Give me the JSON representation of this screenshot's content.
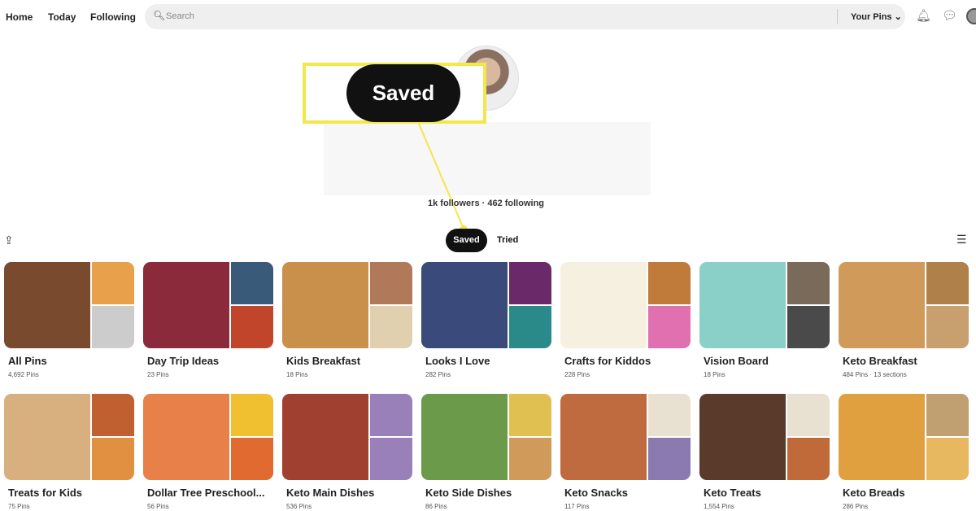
{
  "nav": {
    "home": "Home",
    "today": "Today",
    "following": "Following",
    "search_placeholder": "Search",
    "your_pins": "Your Pins"
  },
  "profile": {
    "stats": "1k followers · 462 following"
  },
  "callout": {
    "label": "Saved",
    "color": "#f2e84a"
  },
  "tabs": [
    {
      "label": "Saved",
      "active": true
    },
    {
      "label": "Tried",
      "active": false
    }
  ],
  "boards": [
    {
      "name": "All Pins",
      "count": "4,692 Pins",
      "colors": [
        "#7a4a2e",
        "#e8a04a",
        "#ccc"
      ]
    },
    {
      "name": "Day Trip Ideas",
      "count": "23 Pins",
      "colors": [
        "#8b2a3a",
        "#3a5a7a",
        "#c0452a"
      ]
    },
    {
      "name": "Kids Breakfast",
      "count": "18 Pins",
      "colors": [
        "#c8904a",
        "#b07a5a",
        "#e0d0b0"
      ]
    },
    {
      "name": "Looks I Love",
      "count": "282 Pins",
      "colors": [
        "#3a4a7a",
        "#6a2a6a",
        "#2a8a8a"
      ]
    },
    {
      "name": "Crafts for Kiddos",
      "count": "228 Pins",
      "colors": [
        "#f5f0e0",
        "#c07a3a",
        "#e070b0"
      ]
    },
    {
      "name": "Vision Board",
      "count": "18 Pins",
      "colors": [
        "#8ad0c8",
        "#7a6a5a",
        "#4a4a4a"
      ]
    },
    {
      "name": "Keto Breakfast",
      "count": "484 Pins · 13 sections",
      "colors": [
        "#d09a5a",
        "#b0804a",
        "#c8a070"
      ]
    },
    {
      "name": "Treats for Kids",
      "count": "75 Pins",
      "colors": [
        "#d8b080",
        "#c06030",
        "#e09040"
      ]
    },
    {
      "name": "Dollar Tree Preschool...",
      "count": "56 Pins",
      "colors": [
        "#e8804a",
        "#f0c030",
        "#e06a30"
      ]
    },
    {
      "name": "Keto Main Dishes",
      "count": "536 Pins",
      "colors": [
        "#a04030",
        "#9a80b8",
        "#9a80b8"
      ]
    },
    {
      "name": "Keto Side Dishes",
      "count": "86 Pins",
      "colors": [
        "#6a9a4a",
        "#e0c050",
        "#d09a5a"
      ]
    },
    {
      "name": "Keto Snacks",
      "count": "117 Pins",
      "colors": [
        "#c06a40",
        "#e8e0d0",
        "#8a7ab0"
      ]
    },
    {
      "name": "Keto Treats",
      "count": "1,554 Pins",
      "colors": [
        "#5a3a2a",
        "#e8e0d0",
        "#c06a3a"
      ]
    },
    {
      "name": "Keto Breads",
      "count": "286 Pins",
      "colors": [
        "#e0a040",
        "#c0a070",
        "#e8b860"
      ]
    }
  ]
}
